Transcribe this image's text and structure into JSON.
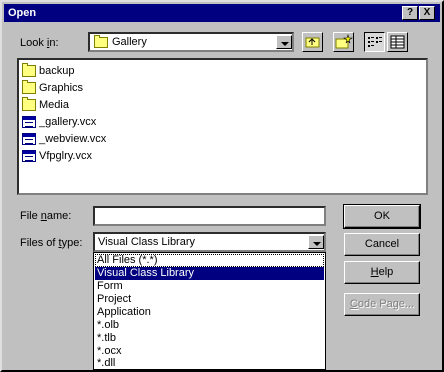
{
  "dialog": {
    "title": "Open",
    "title_buttons": {
      "help": "?",
      "close": "X"
    }
  },
  "lookin": {
    "label_pre": "Look ",
    "label_u": "i",
    "label_post": "n:",
    "value": "Gallery",
    "icon": "folder-icon"
  },
  "toolbar": {
    "up_icon": "up-one-level-icon",
    "new_folder_icon": "new-folder-icon",
    "list_icon": "list-view-icon",
    "details_icon": "details-view-icon"
  },
  "files": [
    {
      "name": "backup",
      "icon": "folder-icon"
    },
    {
      "name": "Graphics",
      "icon": "folder-icon"
    },
    {
      "name": "Media",
      "icon": "folder-icon"
    },
    {
      "name": "_gallery.vcx",
      "icon": "vcx-file-icon"
    },
    {
      "name": "_webview.vcx",
      "icon": "vcx-file-icon"
    },
    {
      "name": "Vfpglry.vcx",
      "icon": "vcx-file-icon"
    }
  ],
  "filename": {
    "label_pre": "File ",
    "label_u": "n",
    "label_post": "ame:",
    "value": ""
  },
  "filetype": {
    "label_pre": "Files of ",
    "label_u": "t",
    "label_post": "ype:",
    "value": "Visual Class Library",
    "options": [
      "All Files (*.*)",
      "Visual Class Library",
      "Form",
      "Project",
      "Application",
      "*.olb",
      "*.tlb",
      "*.ocx",
      "*.dll"
    ],
    "selected_index": 1
  },
  "buttons": {
    "ok": "OK",
    "cancel": "Cancel",
    "help_u": "H",
    "help_rest": "elp",
    "codepage_u": "C",
    "codepage_rest": "ode Page..."
  },
  "colors": {
    "titlebar": "#000080",
    "face": "#c0c0c0",
    "selection": "#000080"
  }
}
